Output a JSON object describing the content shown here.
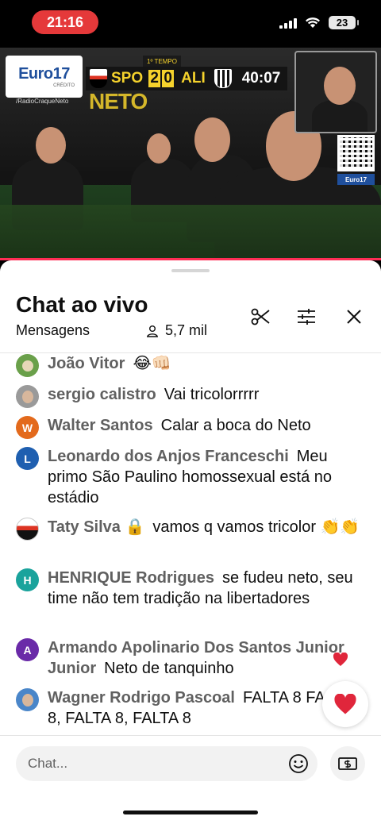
{
  "status_bar": {
    "time": "21:16",
    "battery": "23"
  },
  "video": {
    "sponsor": {
      "name": "Euro17",
      "sub": "CRÉDITO"
    },
    "scoreboard": {
      "period": "1º TEMPO",
      "home": "SPO",
      "home_score": "2",
      "away_score": "0",
      "away": "ALI",
      "clock": "40:07"
    },
    "social_handle": "/RadioCraqueNeto",
    "set_text": "NETO",
    "corner_brand": "Euro17",
    "progress": 1.0
  },
  "chat": {
    "title": "Chat ao vivo",
    "subtitle": "Mensagens",
    "viewers": "5,7 mil",
    "input_placeholder": "Chat...",
    "messages": [
      {
        "author": "João Vitor",
        "text": "😂👊🏻",
        "avatar": "image"
      },
      {
        "author": "sergio calistro",
        "text": "Vai tricolorrrrr",
        "avatar": "image"
      },
      {
        "author": "Walter Santos",
        "text": "Calar a boca do Neto",
        "avatar": "W"
      },
      {
        "author": "Leonardo dos Anjos Franceschi",
        "text": "Meu primo São Paulino homossexual está no estádio",
        "avatar": "L"
      },
      {
        "author": "Taty Silva 🔒",
        "text": "vamos q vamos tricolor 👏👏",
        "avatar": "image"
      },
      {
        "author": "HENRIQUE Rodrigues",
        "text": "se fudeu neto, seu time não tem tradição na libertadores",
        "avatar": "H"
      },
      {
        "author": "Armando Apolinario Dos Santos Junior Junior",
        "text": "Neto de tanquinho",
        "avatar": "A"
      },
      {
        "author": "Wagner Rodrigo Pascoal",
        "text": "FALTA 8 FALTA 8, FALTA 8, FALTA 8",
        "avatar": "image"
      }
    ]
  },
  "colors": {
    "accent_red": "#e5393a",
    "progress": "#ff2d55",
    "heart": "#e0263b",
    "avatar_w": "#e36a1c",
    "avatar_l": "#1f5fb0",
    "avatar_h": "#1aa39c",
    "avatar_a": "#6a2aa8"
  }
}
